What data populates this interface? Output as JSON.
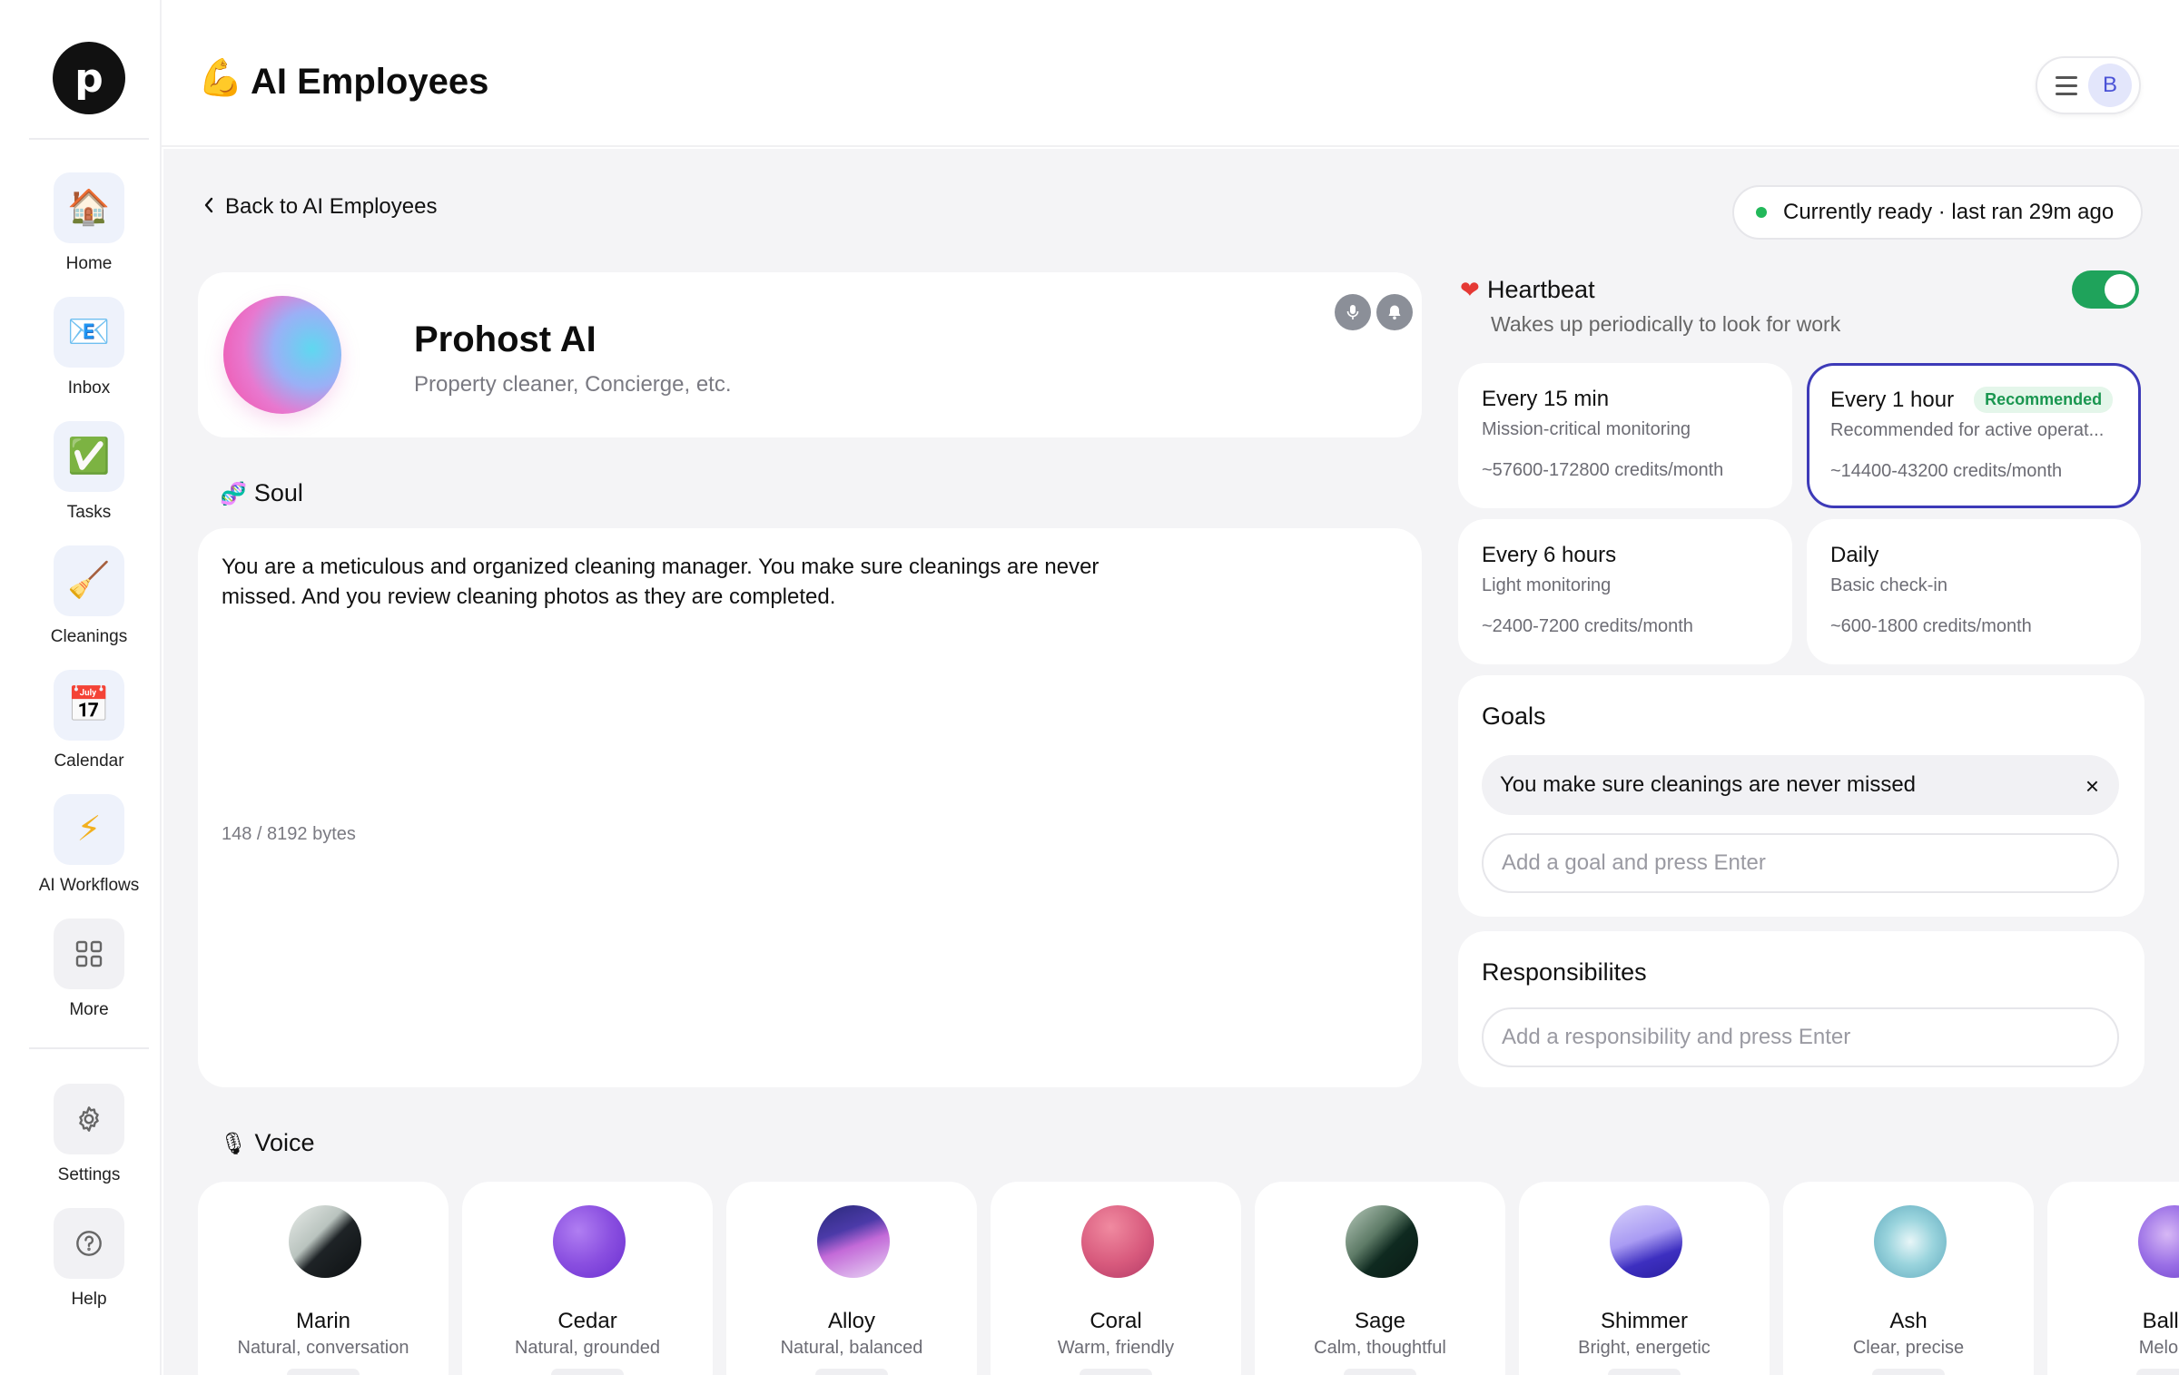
{
  "app": {
    "logo_letter": "p"
  },
  "sidebar": {
    "items": [
      {
        "icon": "house-icon",
        "glyph": "🏠",
        "label": "Home"
      },
      {
        "icon": "envelope-icon",
        "glyph": "📧",
        "label": "Inbox"
      },
      {
        "icon": "checkmark-icon",
        "glyph": "✅",
        "label": "Tasks"
      },
      {
        "icon": "broom-icon",
        "glyph": "🧹",
        "label": "Cleanings"
      },
      {
        "icon": "calendar-icon",
        "glyph": "📅",
        "label": "Calendar"
      },
      {
        "icon": "lightning-icon",
        "glyph": "⚡",
        "label": "AI Workflows"
      },
      {
        "icon": "grid-icon",
        "glyph": "",
        "label": "More"
      }
    ],
    "settings_label": "Settings",
    "help_label": "Help"
  },
  "header": {
    "icon": "flexed-arm-icon",
    "glyph": "💪",
    "title": "AI Employees",
    "avatar_letter": "B"
  },
  "nav": {
    "back_label": "Back to AI Employees"
  },
  "status": {
    "text": "Currently ready · last ran 29m ago",
    "dot_color": "#22b85a"
  },
  "profile": {
    "name": "Prohost AI",
    "subtitle": "Property cleaner, Concierge, etc."
  },
  "soul": {
    "title": "Soul",
    "text": "You are a meticulous and organized cleaning manager. You make sure cleanings are never missed. And you review cleaning photos as they are completed.",
    "bytes": "148 / 8192 bytes"
  },
  "heartbeat": {
    "title": "Heartbeat",
    "subtitle": "Wakes up periodically to look for work",
    "enabled": true,
    "options": [
      {
        "label": "Every 15 min",
        "desc": "Mission-critical monitoring",
        "credits": "~57600-172800 credits/month",
        "selected": false,
        "badge": ""
      },
      {
        "label": "Every 1 hour",
        "desc": "Recommended for active operat...",
        "credits": "~14400-43200 credits/month",
        "selected": true,
        "badge": "Recommended"
      },
      {
        "label": "Every 6 hours",
        "desc": "Light monitoring",
        "credits": "~2400-7200 credits/month",
        "selected": false,
        "badge": ""
      },
      {
        "label": "Daily",
        "desc": "Basic check-in",
        "credits": "~600-1800 credits/month",
        "selected": false,
        "badge": ""
      }
    ]
  },
  "goals": {
    "title": "Goals",
    "items": [
      "You make sure cleanings are never missed"
    ],
    "remove_glyph": "×",
    "input_placeholder": "Add a goal and press Enter"
  },
  "responsibilities": {
    "title": "Responsibilites",
    "input_placeholder": "Add a responsibility and press Enter"
  },
  "voice": {
    "title": "Voice",
    "options": [
      {
        "name": "Marin",
        "desc": "Natural, conversation"
      },
      {
        "name": "Cedar",
        "desc": "Natural, grounded"
      },
      {
        "name": "Alloy",
        "desc": "Natural, balanced"
      },
      {
        "name": "Coral",
        "desc": "Warm, friendly"
      },
      {
        "name": "Sage",
        "desc": "Calm, thoughtful"
      },
      {
        "name": "Shimmer",
        "desc": "Bright, energetic"
      },
      {
        "name": "Ash",
        "desc": "Clear, precise"
      },
      {
        "name": "Ballad",
        "desc": "Melodic,"
      }
    ]
  },
  "colors": {
    "accent": "#3d3ab8",
    "toggle_on": "#1fa35b",
    "recommended": "#1a9650",
    "heart": "#e53935"
  }
}
